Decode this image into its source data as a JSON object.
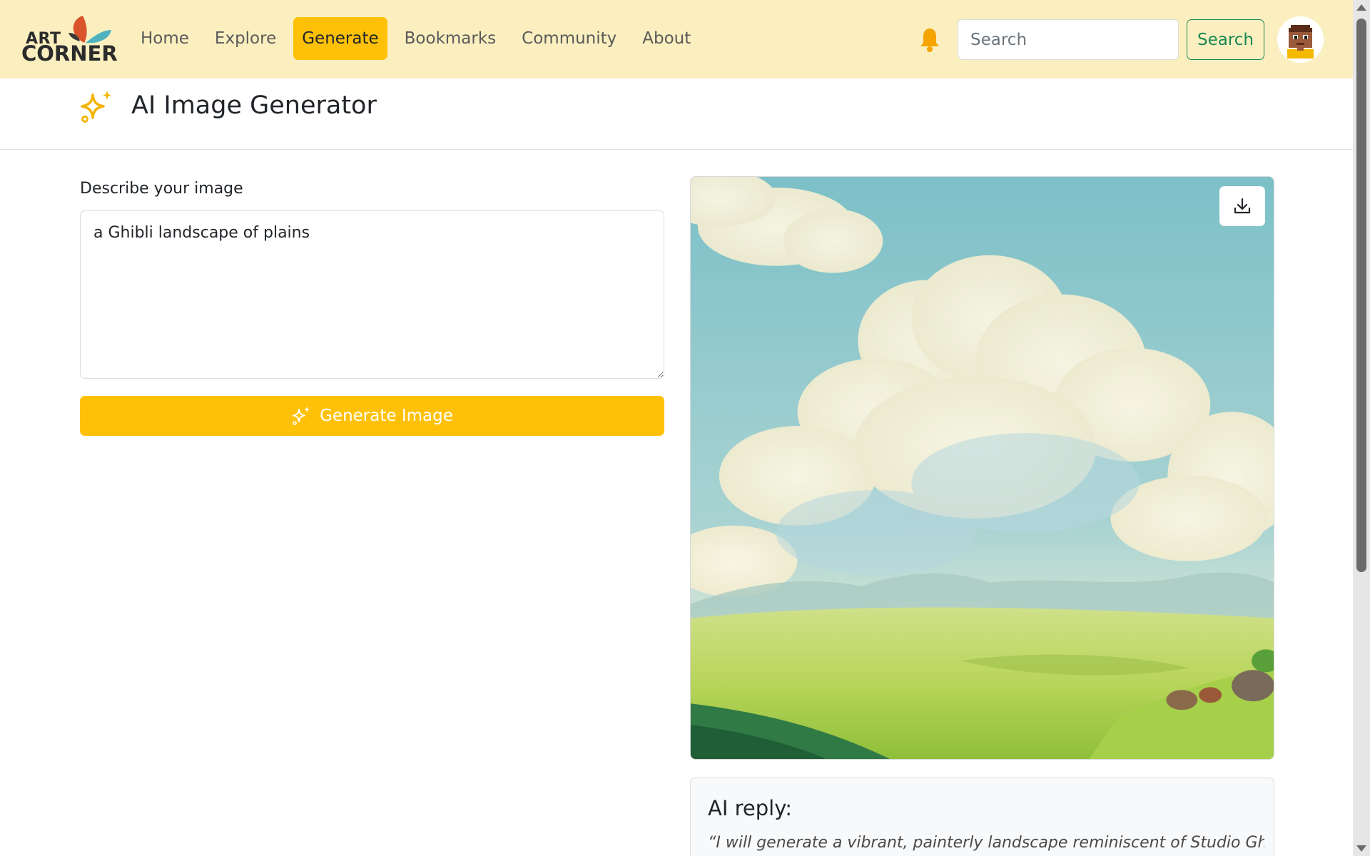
{
  "brand": {
    "line1": "ART",
    "line2": "CORNER"
  },
  "nav": {
    "items": [
      {
        "label": "Home",
        "active": false
      },
      {
        "label": "Explore",
        "active": false
      },
      {
        "label": "Generate",
        "active": true
      },
      {
        "label": "Bookmarks",
        "active": false
      },
      {
        "label": "Community",
        "active": false
      },
      {
        "label": "About",
        "active": false
      }
    ],
    "bell_icon": "bell-icon",
    "search_placeholder": "Search",
    "search_button": "Search",
    "avatar_icon": "user-avatar"
  },
  "header": {
    "icon": "sparkles-icon",
    "title": "AI Image Generator"
  },
  "form": {
    "label": "Describe your image",
    "prompt_value": "a Ghibli landscape of plains",
    "generate_label": "Generate Image",
    "generate_icon": "sparkles-icon"
  },
  "result": {
    "download_icon": "download-icon",
    "image_alt": "Ghibli-style green plains under a cloudy blue sky",
    "reply_title": "AI reply:",
    "reply_text": "“I will generate a vibrant, painterly landscape reminiscent of Studio Ghibli"
  },
  "colors": {
    "navbar_bg": "#fbefc0",
    "accent": "#ffc107",
    "search_button": "#198754",
    "bell": "#f5a400"
  }
}
